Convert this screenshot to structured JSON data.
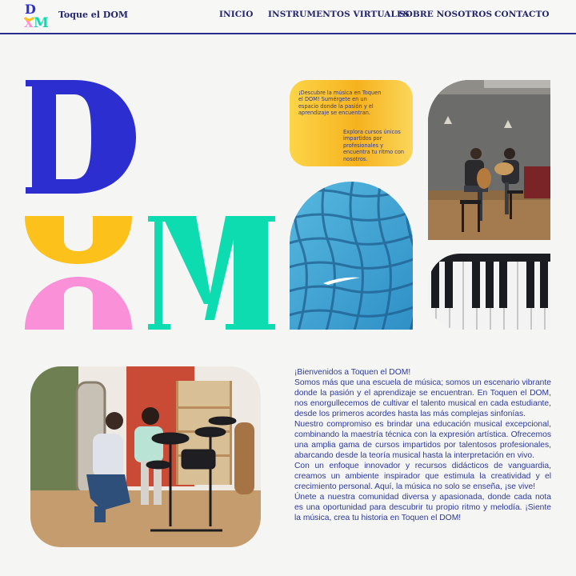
{
  "header": {
    "brand": "Toque el DOM",
    "logo_letters": [
      "D",
      "X",
      "M"
    ],
    "nav": [
      "INICIO",
      "INSTRUMENTOS VIRTUALES",
      "SOBRE NOSOTROS",
      "CONTACTO"
    ]
  },
  "hero": {
    "letters": [
      "D",
      "M"
    ],
    "bubble": {
      "text1": "¡Descubre la música en Toquen el DOM! Sumérgete en un espacio donde la pasión y el aprendizaje se encuentran.",
      "text2": "Explora cursos únicos impartidos por profesionales y encuentra tu ritmo con nosotros."
    },
    "images": [
      "guitar-lesson-photo",
      "pool-water-photo",
      "piano-keys-photo",
      "drum-lesson-photo"
    ]
  },
  "welcome": {
    "paragraphs": [
      "¡Bienvenidos a Toquen el DOM!",
      "Somos más que una escuela de música; somos un escenario vibrante donde la pasión y el aprendizaje se encuentran. En Toquen el DOM, nos enorgullecemos de cultivar el talento musical en cada estudiante, desde los primeros acordes hasta las más complejas sinfonías.",
      "Nuestro compromiso es brindar una educación musical excepcional, combinando la maestría técnica con la expresión artística. Ofrecemos una amplia gama de cursos impartidos por talentosos profesionales, abarcando desde la teoría musical hasta la interpretación en vivo.",
      "Con un enfoque innovador y recursos didácticos de vanguardia, creamos un ambiente inspirador que estimula la creatividad y el crecimiento personal. Aquí, la música no solo se enseña, ¡se vive!",
      "Únete a nuestra comunidad diversa y apasionada, donde cada nota es una oportunidad para descubrir tu propio ritmo y melodía. ¡Siente la música, crea tu historia en Toquen el DOM!"
    ]
  },
  "colors": {
    "navy": "#23246e",
    "blue": "#2c2ed0",
    "yellow": "#fcc21b",
    "pink": "#f990d8",
    "teal": "#0cdcaf"
  }
}
